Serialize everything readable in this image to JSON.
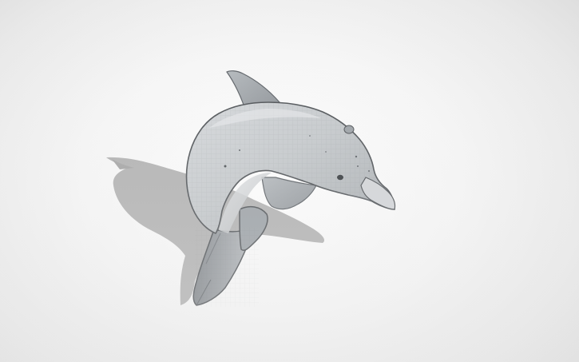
{
  "scene": {
    "subject_icon": "dolphin-model-icon",
    "colors": {
      "background_center": "#ffffff",
      "background_edge": "#dddddd",
      "shadow": "#a9a9a9",
      "body_light": "#c9cdd0",
      "body_mid": "#aeb3b7",
      "body_dark": "#7f858a",
      "outline": "#4a4e52",
      "eye": "#2f3337"
    }
  }
}
